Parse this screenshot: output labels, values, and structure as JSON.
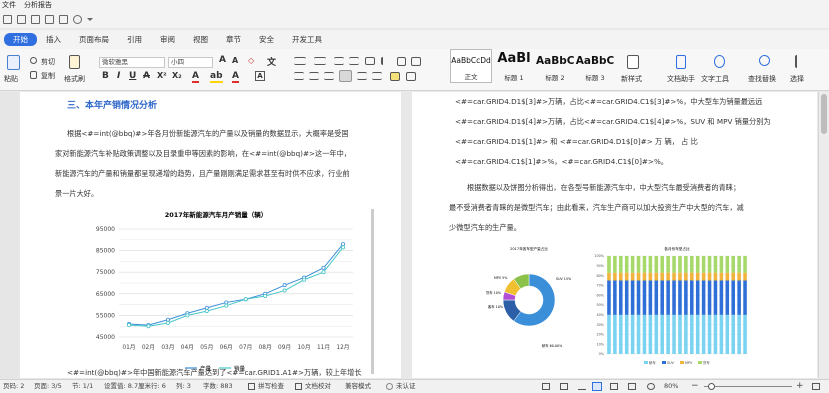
{
  "menu": {
    "file": "文件",
    "analysis": "分析报告"
  },
  "tabs": [
    "开始",
    "插入",
    "页面布局",
    "引用",
    "审阅",
    "视图",
    "章节",
    "安全",
    "开发工具"
  ],
  "ribbon": {
    "paste": "粘贴",
    "cut": "剪切",
    "copy": "复制",
    "format_painter": "格式刷",
    "font": "微软雅黑",
    "size": "小四",
    "styles": [
      {
        "preview": "AaBbCcDd",
        "caption": "正文"
      },
      {
        "preview": "AaBl",
        "caption": "标题 1"
      },
      {
        "preview": "AaBbC",
        "caption": "标题 2"
      },
      {
        "preview": "AaBbC",
        "caption": "标题 3"
      }
    ],
    "new_style": "新样式",
    "doc_helper": "文档助手",
    "text_tools": "文字工具",
    "find_replace": "查找替换",
    "select": "选择"
  },
  "page1": {
    "heading": "三、本年产销情况分析",
    "lines": [
      "根据<#=int(@bbq)#>年各月份新能源汽车的产量以及销量的数据显示，大概率是受国",
      "家对新能源汽车补贴政策调整以及目录重申等因素的影响，在<#=int(@bbq)#>这一年中，",
      "新能源汽车的产量和销量都呈现递增的趋势，且产量刚刚满足需求甚至有时供不应求，行业前",
      "景一片大好。"
    ],
    "bottom_line": "<#=int(@bbq)#>年中国新能源汽车产量达到了<#=car.GRID1.A1#>万辆，较上年增长"
  },
  "chart_data": [
    {
      "type": "line",
      "title": "2017年新能源汽车月产销量（辆）",
      "categories": [
        "01月",
        "02月",
        "03月",
        "04月",
        "05月",
        "06月",
        "07月",
        "08月",
        "09月",
        "10月",
        "11月",
        "12月"
      ],
      "series": [
        {
          "name": "产量",
          "values": [
            51000,
            50500,
            53000,
            56000,
            58500,
            61000,
            62500,
            65000,
            69000,
            72500,
            77000,
            88000
          ]
        },
        {
          "name": "销量",
          "values": [
            50500,
            50000,
            51500,
            55000,
            57000,
            59500,
            62500,
            64000,
            66500,
            71500,
            75000,
            86500
          ]
        }
      ],
      "ylim": [
        45000,
        95000
      ],
      "yticks": [
        "45000",
        "55000",
        "65000",
        "75000",
        "85000",
        "95000"
      ],
      "yticks_minor": [
        50000,
        60000,
        70000,
        80000,
        90000
      ],
      "colors": [
        "#3a8fd8",
        "#47c6c6"
      ],
      "legend": "bottom"
    },
    {
      "type": "pie",
      "title": "2017年各车型产量占比",
      "series": [
        {
          "name": "轿车",
          "values": [
            60
          ],
          "color": "#3a8fd8"
        },
        {
          "name": "SUV",
          "values": [
            15
          ],
          "color": "#2d5ea8"
        },
        {
          "name": "MPV",
          "values": [
            5
          ],
          "color": "#b150d6"
        },
        {
          "name": "客车",
          "values": [
            10
          ],
          "color": "#f0c030"
        },
        {
          "name": "货车",
          "values": [
            10
          ],
          "color": "#8cc24a"
        }
      ],
      "legend": "none"
    },
    {
      "type": "bar",
      "title": "各月份车型占比",
      "categories": [
        "1",
        "2",
        "3",
        "4",
        "5",
        "6",
        "7",
        "8",
        "9",
        "10",
        "11",
        "12",
        "13",
        "14",
        "15",
        "16",
        "17",
        "18",
        "19",
        "20",
        "21",
        "22",
        "23",
        "24"
      ],
      "series": [
        {
          "name": "轿车",
          "values": [
            0.4,
            0.4,
            0.4,
            0.4,
            0.4,
            0.4,
            0.4,
            0.4,
            0.4,
            0.4,
            0.4,
            0.4,
            0.4,
            0.4,
            0.4,
            0.4,
            0.4,
            0.4,
            0.4,
            0.4,
            0.4,
            0.4,
            0.4,
            0.4
          ],
          "color": "#7ad3f0"
        },
        {
          "name": "SUV",
          "values": [
            0.35,
            0.35,
            0.35,
            0.35,
            0.35,
            0.35,
            0.35,
            0.35,
            0.35,
            0.35,
            0.35,
            0.35,
            0.35,
            0.35,
            0.35,
            0.35,
            0.35,
            0.35,
            0.35,
            0.35,
            0.35,
            0.35,
            0.35,
            0.35
          ],
          "color": "#2f6fd8"
        },
        {
          "name": "MPV",
          "values": [
            0.08,
            0.08,
            0.08,
            0.08,
            0.08,
            0.08,
            0.08,
            0.08,
            0.08,
            0.08,
            0.08,
            0.08,
            0.08,
            0.08,
            0.08,
            0.08,
            0.08,
            0.08,
            0.08,
            0.08,
            0.08,
            0.08,
            0.08,
            0.08
          ],
          "color": "#f0b43c"
        },
        {
          "name": "货车",
          "values": [
            0.17,
            0.17,
            0.17,
            0.17,
            0.17,
            0.17,
            0.17,
            0.17,
            0.17,
            0.17,
            0.17,
            0.17,
            0.17,
            0.17,
            0.17,
            0.17,
            0.17,
            0.17,
            0.17,
            0.17,
            0.17,
            0.17,
            0.17,
            0.17
          ],
          "color": "#a6d96a"
        }
      ],
      "yticks": [
        "100%",
        "90%",
        "80%",
        "70%",
        "60%",
        "50%",
        "40%",
        "30%",
        "20%",
        "10%",
        "0%"
      ],
      "ylim": [
        0,
        1
      ],
      "legend": "bottom"
    }
  ],
  "page2": {
    "lines": [
      "<#=car.GRID4.D1$[3]#>万辆，占比<#=car.GRID4.C1$[3]#>%，中大型车为销量最远远",
      "<#=car.GRID4.D1$[4]#>万辆，占比<#=car.GRID4.C1$[4]#>%，SUV 和 MPV 销量分别为",
      "<#=car.GRID4.D1$[1]#>        和        <#=car.GRID4.D1$[0]#>        万        辆，        占        比",
      "<#=car.GRID4.C1$[1]#>%，<#=car.GRID4.C1$[0]#>%。"
    ],
    "para2": [
      "根据数据以及饼图分析得出，在各型号新能源汽车中，中大型汽车最受消费者的青睐；",
      "最不受消费者青睐的是微型汽车；由此看来，汽车生产商可以加大投资生产中大型的汽车，减",
      "少微型汽车的生产量。"
    ],
    "pie_labels": [
      "轿车 60.00%",
      "SUV 15%",
      "MPV 5%",
      "货车 10%",
      "客车 10%"
    ]
  },
  "status": {
    "page_no": "页码: 2",
    "pages": "页面: 3/5",
    "section": "节: 1/1",
    "setting": "设置值: 8.7厘米",
    "row": "行: 6",
    "col": "列: 3",
    "words": "字数: 883",
    "spell": "拼写检查",
    "compare": "文档校对",
    "compat": "兼容模式",
    "auth": "未认证",
    "zoom": "80%"
  },
  "colors": {
    "accent": "#2f6fe0",
    "heading": "#2e66c8"
  }
}
